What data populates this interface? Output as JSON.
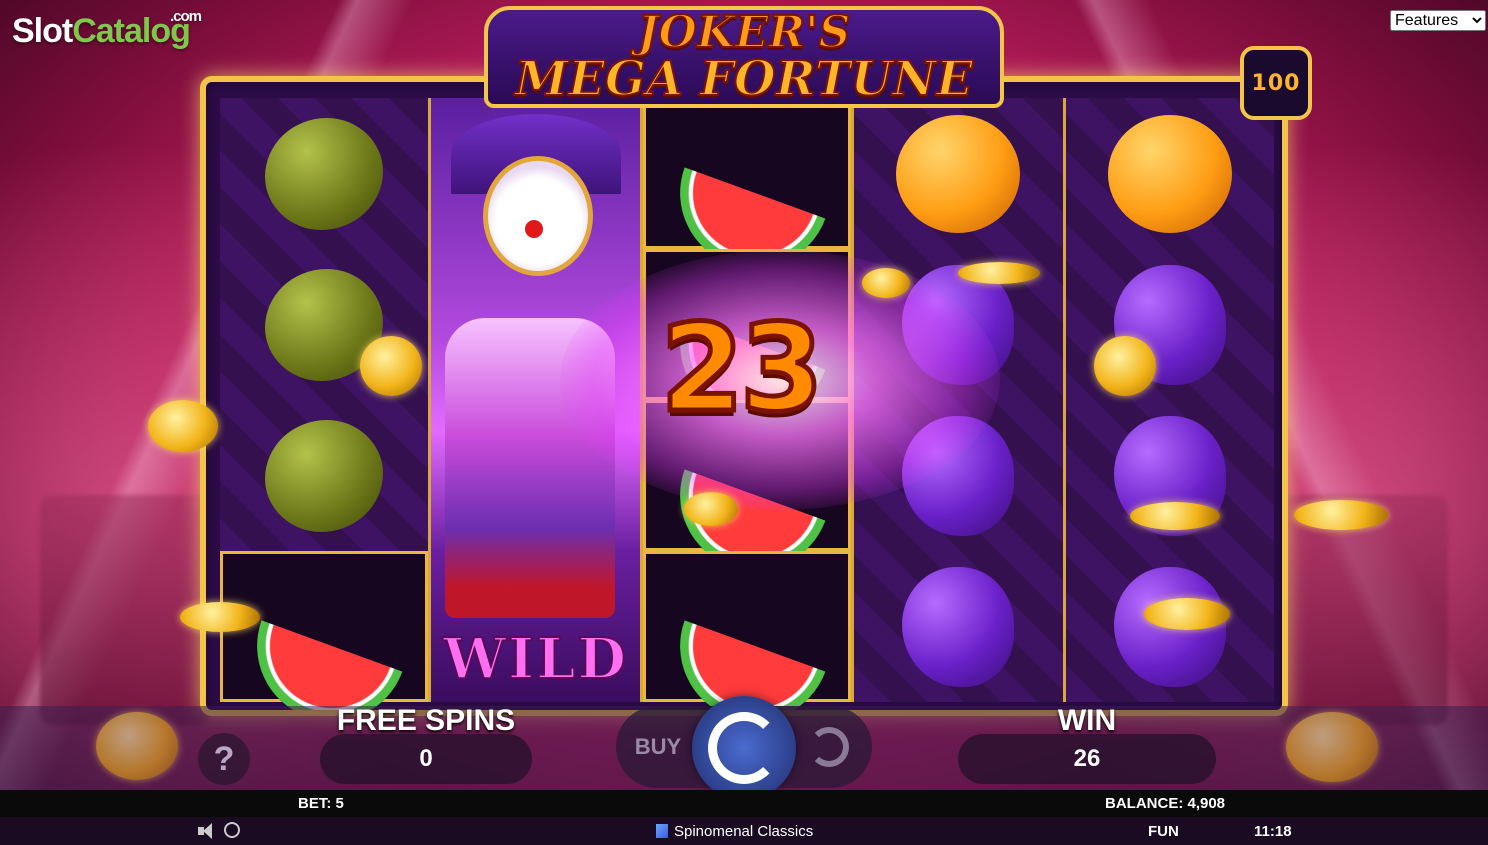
{
  "watermark": {
    "brand_left": "Slot",
    "brand_right": "Catalog",
    "suffix": ".com"
  },
  "features_dropdown": {
    "selected": "Features"
  },
  "game": {
    "title_line1": "JOKER'S",
    "title_line2": "MEGA FORTUNE",
    "multiplier_badge": "100",
    "win_popup": "23",
    "wild_label": "WILD"
  },
  "reels": {
    "reel1": [
      "lemon",
      "lemon",
      "lemon",
      "watermelon"
    ],
    "reel2": [
      "joker-wild"
    ],
    "reel3": [
      "watermelon",
      "watermelon",
      "watermelon",
      "watermelon"
    ],
    "reel4": [
      "orange",
      "plum",
      "plum",
      "plum"
    ],
    "reel5": [
      "orange",
      "plum",
      "plum",
      "plum"
    ]
  },
  "hud": {
    "help_label": "?",
    "free_spins_label": "FREE SPINS",
    "free_spins_value": "0",
    "buy_label": "BUY",
    "win_label": "WIN",
    "win_value": "26"
  },
  "status": {
    "bet": "BET: 5",
    "balance": "BALANCE: 4,908",
    "provider": "Spinomenal Classics",
    "mode": "FUN",
    "time": "11:18"
  }
}
